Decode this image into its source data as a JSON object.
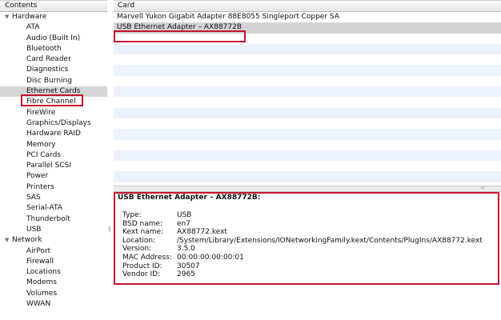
{
  "sidebar": {
    "header": "Contents",
    "groups": [
      {
        "label": "Hardware",
        "items": [
          "ATA",
          "Audio (Built In)",
          "Bluetooth",
          "Card Reader",
          "Diagnostics",
          "Disc Burning",
          "Ethernet Cards",
          "Fibre Channel",
          "FireWire",
          "Graphics/Displays",
          "Hardware RAID",
          "Memory",
          "PCI Cards",
          "Parallel SCSI",
          "Power",
          "Printers",
          "SAS",
          "Serial-ATA",
          "Thunderbolt",
          "USB"
        ]
      },
      {
        "label": "Network",
        "items": [
          "AirPort",
          "Firewall",
          "Locations",
          "Modems",
          "Volumes",
          "WWAN"
        ]
      }
    ],
    "selected": "Ethernet Cards"
  },
  "list": {
    "header": "Card",
    "rows": [
      "Marvell Yukon Gigabit Adapter 88E8055 Singleport Copper SA",
      "USB Ethernet Adapter – AX88772B"
    ],
    "selected_index": 1
  },
  "detail": {
    "title": "USB Ethernet Adapter – AX88772B:",
    "properties": [
      {
        "key": "Type:",
        "value": "USB"
      },
      {
        "key": "BSD name:",
        "value": "en7"
      },
      {
        "key": "Kext name:",
        "value": "AX88772.kext"
      },
      {
        "key": "Location:",
        "value": "/System/Library/Extensions/IONetworkingFamily.kext/Contents/PlugIns/AX88772.kext"
      },
      {
        "key": "Version:",
        "value": "3.5.0"
      },
      {
        "key": "MAC Address:",
        "value": "00:00:00:00:00:01"
      },
      {
        "key": "Product ID:",
        "value": "30507"
      },
      {
        "key": "Vendor ID:",
        "value": "2965"
      }
    ]
  },
  "colors": {
    "highlight_box": "#c8102e",
    "selection": "#d6d6d6",
    "stripe": "#edf3fe"
  },
  "icons": {
    "expanded": "disclosure-triangle-down-icon",
    "splitter": "splitter-grip-icon"
  }
}
